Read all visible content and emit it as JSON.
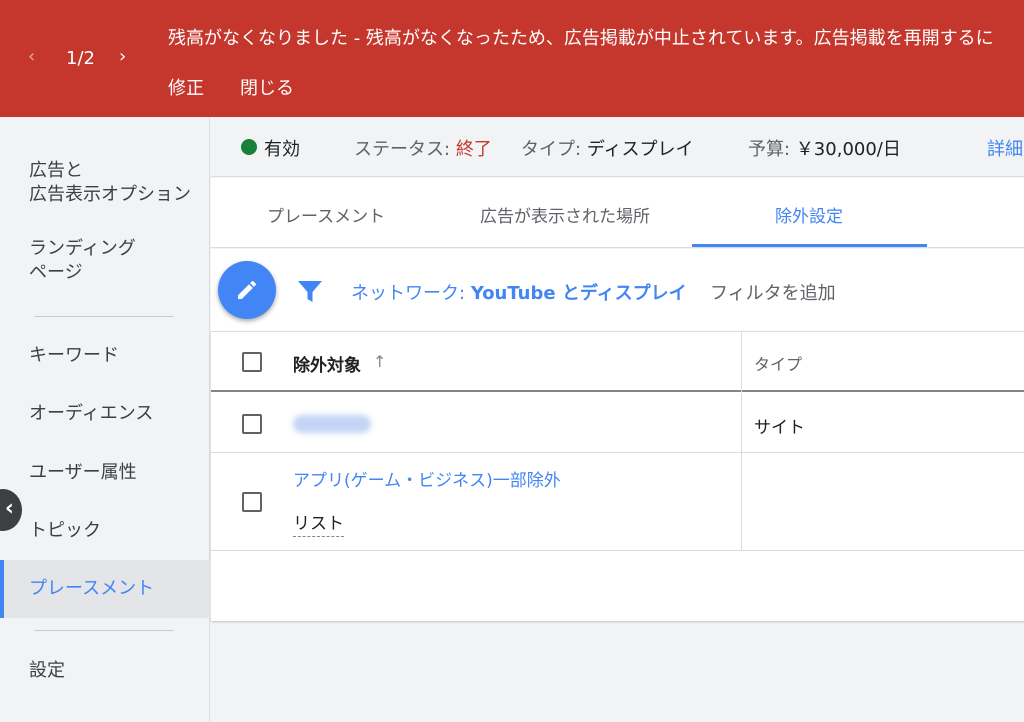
{
  "banner": {
    "pager": "1/2",
    "prev_icon": "chevron-left-icon",
    "next_icon": "chevron-right-icon",
    "message": "残高がなくなりました - 残高がなくなったため、広告掲載が中止されています。広告掲載を再開するに",
    "fix_label": "修正",
    "close_label": "閉じる",
    "color": "#c5372c"
  },
  "sidebar": {
    "items": [
      {
        "label": "広告と\n広告表示オプション"
      },
      {
        "label": "ランディング\nページ"
      },
      {
        "label": "キーワード"
      },
      {
        "label": "オーディエンス"
      },
      {
        "label": "ユーザー属性"
      },
      {
        "label": "トピック"
      },
      {
        "label": "プレースメント",
        "active": true
      },
      {
        "label": "設定"
      }
    ],
    "collapse_icon": "chevron-left-icon"
  },
  "status": {
    "enabled": "有効",
    "status_label": "ステータス:",
    "status_value": "終了",
    "type_label": "タイプ:",
    "type_value": "ディスプレイ",
    "budget_label": "予算:",
    "budget_value": "￥30,000/日",
    "details_link": "詳細"
  },
  "tabs": [
    {
      "label": "プレースメント"
    },
    {
      "label": "広告が表示された場所"
    },
    {
      "label": "除外設定",
      "active": true
    }
  ],
  "filter": {
    "edit_icon": "pencil-icon",
    "filter_icon": "funnel-icon",
    "chip_label": "ネットワーク:",
    "chip_value": "YouTube とディスプレイ",
    "add_filter": "フィルタを追加"
  },
  "table": {
    "columns": [
      "除外対象",
      "タイプ"
    ],
    "sort_icon": "arrow-up-icon",
    "rows": [
      {
        "name": "",
        "type": "サイト"
      },
      {
        "name": "アプリ(ゲーム・ビジネス)一部除外",
        "subtype": "リスト",
        "type": ""
      }
    ]
  },
  "accent": "#4285f4"
}
